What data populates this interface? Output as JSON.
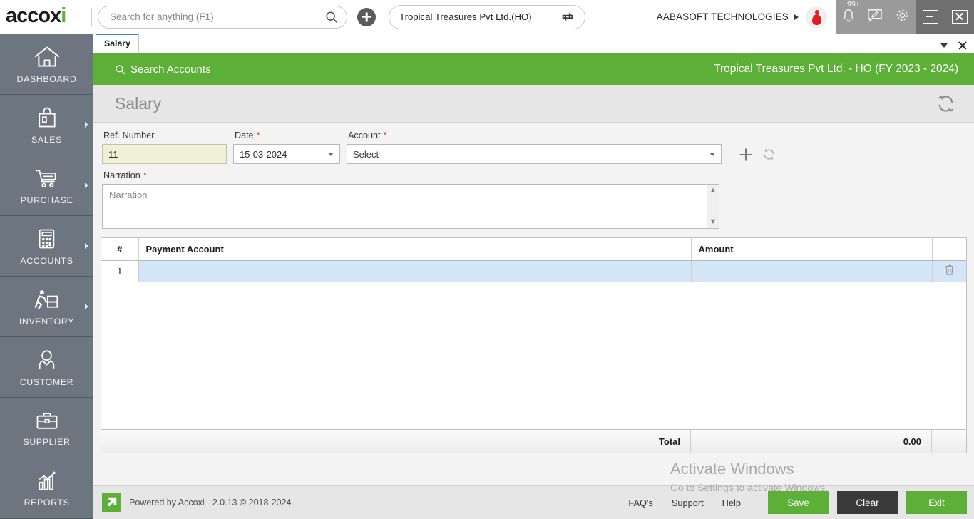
{
  "topbar": {
    "logo_text": "accox",
    "logo_accent": "i",
    "search_placeholder": "Search for anything (F1)",
    "search_value": "",
    "add_button_label": "+",
    "company_selector": "Tropical Treasures Pvt Ltd.(HO)",
    "organization": "AABASOFT TECHNOLOGIES",
    "notification_badge": "99+",
    "icons": [
      "bell-icon",
      "message-icon",
      "gear-icon"
    ],
    "window_controls": [
      "minimize",
      "close"
    ]
  },
  "sidebar": {
    "items": [
      {
        "label": "DASHBOARD",
        "icon": "home-icon",
        "has_arrow": false
      },
      {
        "label": "SALES",
        "icon": "shopping-bag-icon",
        "has_arrow": true
      },
      {
        "label": "PURCHASE",
        "icon": "shopping-cart-icon",
        "has_arrow": true
      },
      {
        "label": "ACCOUNTS",
        "icon": "calculator-icon",
        "has_arrow": true
      },
      {
        "label": "INVENTORY",
        "icon": "warehouse-worker-icon",
        "has_arrow": true
      },
      {
        "label": "CUSTOMER",
        "icon": "person-icon",
        "has_arrow": false
      },
      {
        "label": "SUPPLIER",
        "icon": "briefcase-icon",
        "has_arrow": false
      },
      {
        "label": "REPORTS",
        "icon": "bar-chart-icon",
        "has_arrow": false
      }
    ]
  },
  "tabbar": {
    "tabs": [
      {
        "label": "Salary",
        "active": true
      }
    ]
  },
  "greenbar": {
    "search_accounts_label": "Search Accounts",
    "fiscal_info": "Tropical Treasures Pvt Ltd. - HO (FY 2023 - 2024)"
  },
  "pagehead": {
    "title": "Salary",
    "refresh_icon": "refresh-icon"
  },
  "form": {
    "ref_number": {
      "label": "Ref. Number",
      "value": "11",
      "required": false
    },
    "date": {
      "label": "Date",
      "value": "15-03-2024",
      "required": true
    },
    "account": {
      "label": "Account",
      "value": "Select",
      "required": true
    },
    "narration": {
      "label": "Narration",
      "placeholder": "Narration",
      "value": "",
      "required": true
    },
    "add_account_icon": "plus-icon",
    "refresh_account_icon": "refresh-icon"
  },
  "table": {
    "columns": [
      "#",
      "Payment Account",
      "Amount",
      ""
    ],
    "rows": [
      {
        "index": "1",
        "payment_account": "",
        "amount": "",
        "delete_icon": "trash-icon",
        "selected": true
      }
    ],
    "total_label": "Total",
    "total_value": "0.00"
  },
  "footer": {
    "powered_by": "Powered by Accoxi - 2.0.13 © 2018-2024",
    "links": [
      "FAQ's",
      "Support",
      "Help"
    ],
    "buttons": [
      {
        "label": "Save",
        "accel": "S",
        "style": "green"
      },
      {
        "label": "Clear",
        "accel": "C",
        "style": "dark"
      },
      {
        "label": "Exit",
        "accel": "E",
        "style": "green"
      }
    ]
  },
  "watermark": {
    "line1": "Activate Windows",
    "line2": "Go to Settings to activate Windows."
  },
  "colors": {
    "brand_green": "#5cb037",
    "sidebar_gray": "#6d7680",
    "cream_field": "#f0f0d7",
    "row_selected": "#d3e6f8",
    "required_red": "#e03b2f"
  }
}
